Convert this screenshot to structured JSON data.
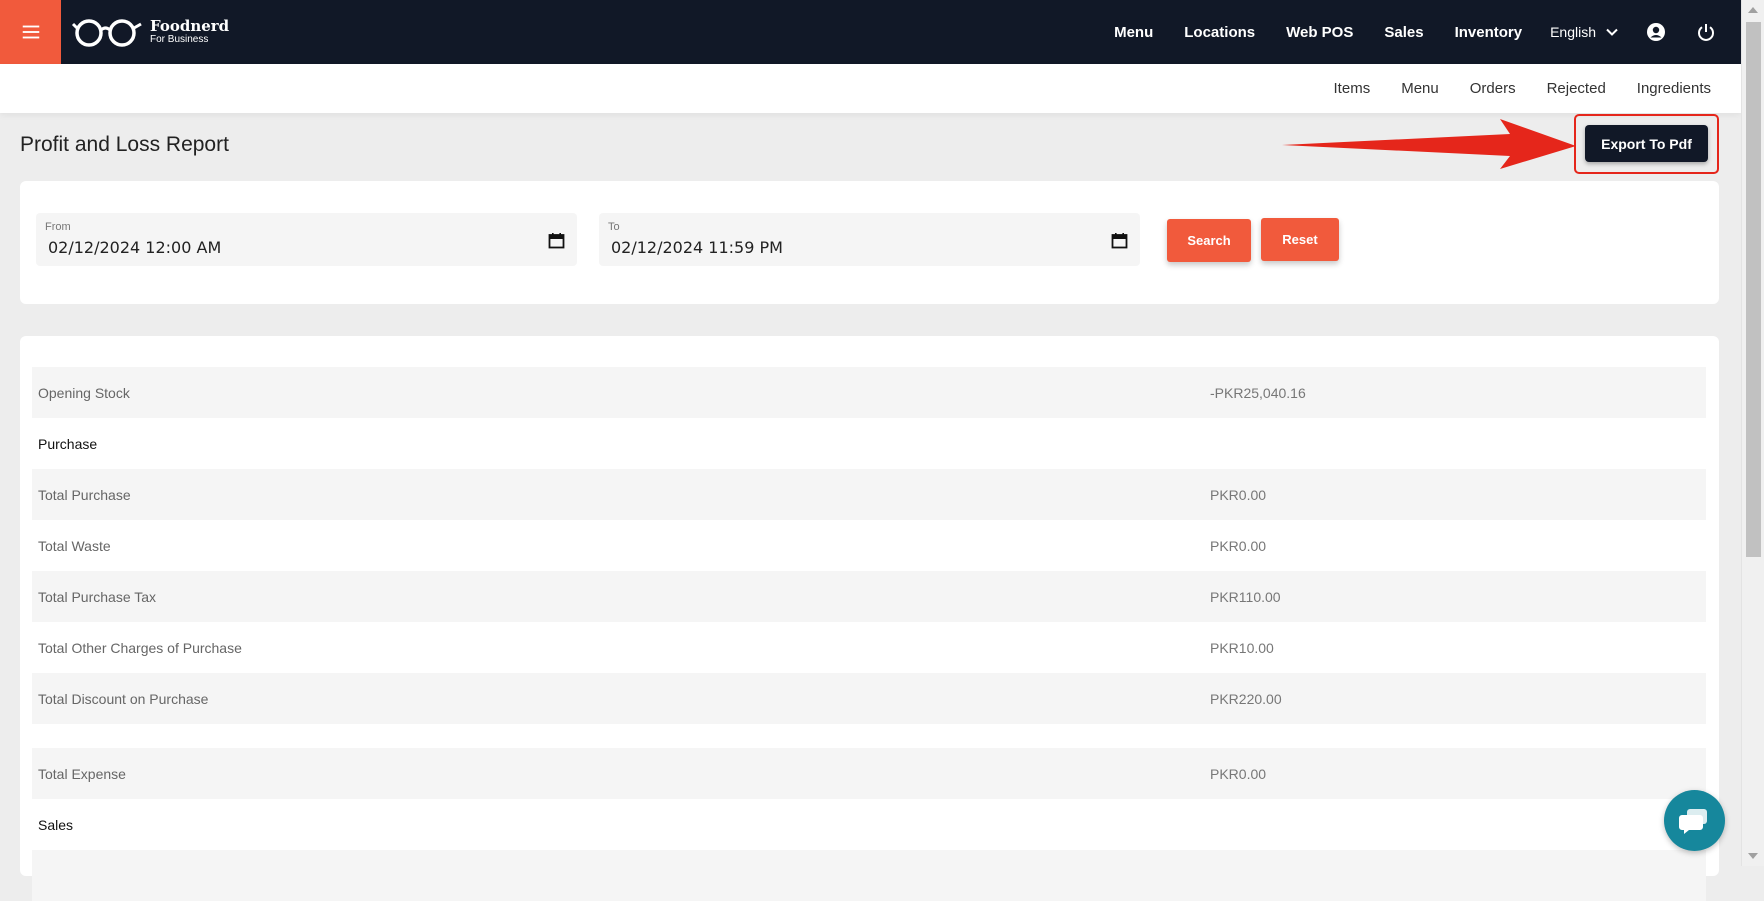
{
  "brand": {
    "title": "Foodnerd",
    "subtitle": "For Business",
    "accent_color": "#f15a3c",
    "nav_bg_color": "#111827"
  },
  "topnav": {
    "items": [
      "Menu",
      "Locations",
      "Web POS",
      "Sales",
      "Inventory"
    ],
    "language": "English",
    "icons": [
      "hamburger-menu-icon",
      "glasses-logo-icon",
      "chevron-down-icon",
      "account-circle-icon",
      "power-icon"
    ]
  },
  "subnav": {
    "items": [
      "Items",
      "Menu",
      "Orders",
      "Rejected",
      "Ingredients"
    ]
  },
  "page": {
    "title": "Profit and Loss Report",
    "export_label": "Export To Pdf"
  },
  "filters": {
    "from_label": "From",
    "from_value": "02/12/2024 12:00 AM",
    "to_label": "To",
    "to_value": "02/12/2024 11:59 PM",
    "search_label": "Search",
    "reset_label": "Reset"
  },
  "report": {
    "rows": [
      {
        "label": "Opening Stock",
        "value": "-PKR25,040.16"
      },
      {
        "label": "Purchase",
        "value": ""
      },
      {
        "label": "Total Purchase",
        "value": "PKR0.00"
      },
      {
        "label": "Total Waste",
        "value": "PKR0.00"
      },
      {
        "label": "Total Purchase Tax",
        "value": "PKR110.00"
      },
      {
        "label": "Total Other Charges of Purchase",
        "value": "PKR10.00"
      },
      {
        "label": "Total Discount on Purchase",
        "value": "PKR220.00"
      },
      {
        "label": "Total Expense",
        "value": "PKR0.00"
      },
      {
        "label": "Sales",
        "value": ""
      }
    ]
  },
  "annotation": {
    "arrow_color": "#e5261b"
  }
}
